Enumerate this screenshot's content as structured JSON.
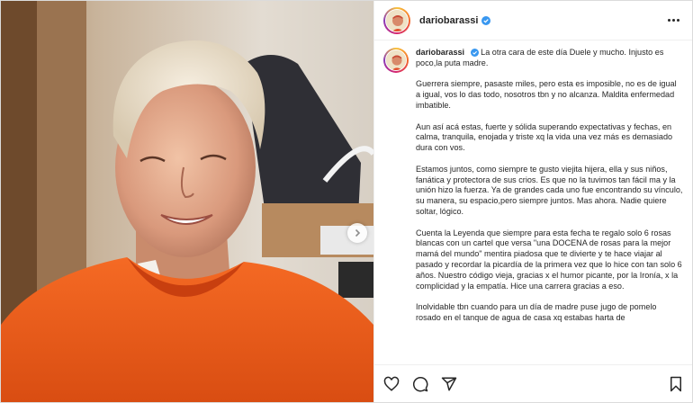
{
  "post": {
    "username": "dariobarassi",
    "verified": true,
    "caption": {
      "username": "dariobarassi",
      "paragraphs": [
        "La otra cara de este día Duele y mucho. Injusto es poco,la puta madre.",
        "Guerrera siempre, pasaste miles, pero esta es imposible, no es de igual a igual, vos lo das todo, nosotros tbn y no alcanza. Maldita enfermedad imbatible.",
        "Aun así acá estas, fuerte y sólida superando expectativas y fechas, en calma, tranquila, enojada y triste xq la vida una vez más es demasiado dura con vos.",
        "Estamos juntos, como siempre te gusto viejita hijera, ella y sus niños, fanática y protectora de sus crios. Es que no la tuvimos tan fácil ma y la unión hizo la fuerza. Ya de grandes cada uno fue encontrando su vínculo, su manera, su espacio,pero siempre juntos. Mas ahora. Nadie quiere soltar, lógico.",
        "Cuenta la Leyenda que siempre para esta fecha te regalo solo 6 rosas blancas con un cartel que versa \"una DOCENA de rosas para la mejor mamá del mundo\" mentira piadosa que te divierte y te hace viajar al pasado y recordar la picardía de la primera vez que lo hice con tan solo 6 años. Nuestro código vieja, gracias x el humor picante, por la Ironía, x la complicidad y la empatía. Hice una carrera gracias a eso.",
        "Inolvidable tbn cuando para un día de madre puse jugo de pomelo rosado en el tanque de agua de casa xq estabas harta de"
      ]
    }
  },
  "icons": {
    "more": "more-horizontal-icon",
    "like": "heart-icon",
    "comment": "comment-icon",
    "share": "share-icon",
    "save": "bookmark-icon",
    "verified": "verified-badge-icon",
    "next": "chevron-right-icon"
  },
  "colors": {
    "verified": "#3897f0",
    "text": "#262626",
    "shirt": "#f0601c"
  }
}
